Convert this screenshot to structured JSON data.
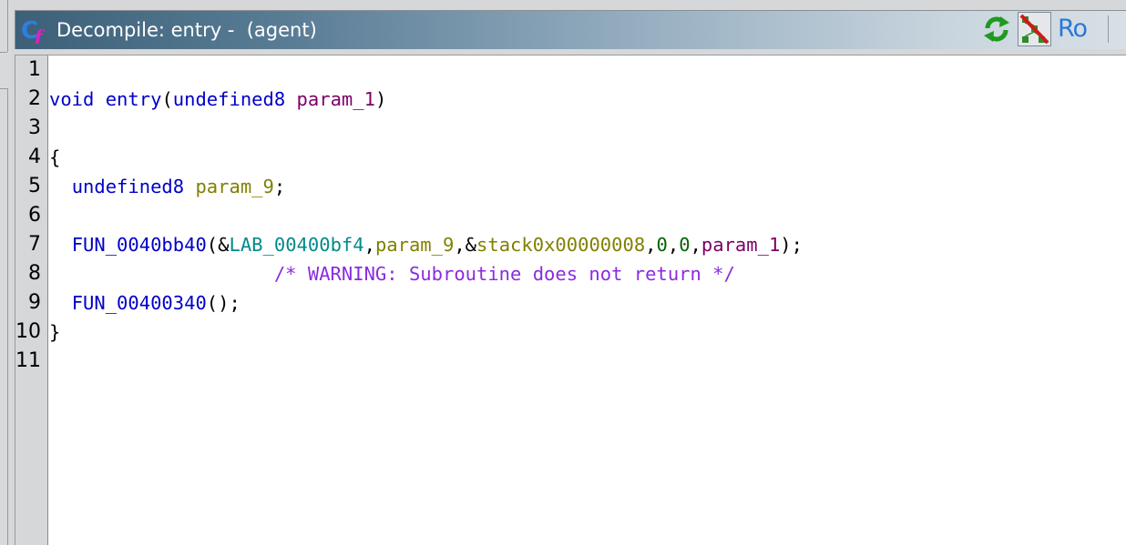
{
  "window": {
    "title": "Decompile: entry -  (agent)",
    "title_icon": "decompiler-cf-icon",
    "toolbar": {
      "refresh_icon": "refresh-icon",
      "graph_icon": "function-graph-icon",
      "ro_label": "Ro"
    }
  },
  "code": {
    "line_numbers": [
      "1",
      "2",
      "3",
      "4",
      "5",
      "6",
      "7",
      "8",
      "9",
      "10",
      "11"
    ],
    "lines": {
      "l2": {
        "kw_void": "void",
        "fn_name": "entry",
        "open": "(",
        "type": "undefined8",
        "param": "param_1",
        "close": ")"
      },
      "l4": {
        "brace": "{"
      },
      "l5": {
        "type": "undefined8",
        "var": "param_9",
        "semi": ";"
      },
      "l7": {
        "fn": "FUN_0040bb40",
        "p1": "(&",
        "label": "LAB_00400bf4",
        "c1": ",",
        "var": "param_9",
        "c2": ",&",
        "stack": "stack0x00000008",
        "c3": ",",
        "zero1": "0",
        "c4": ",",
        "zero2": "0",
        "c5": ",",
        "param": "param_1",
        "end": ");"
      },
      "l8": {
        "comment": "/* WARNING: Subroutine does not return */"
      },
      "l9": {
        "fn": "FUN_00400340",
        "end": "();"
      },
      "l10": {
        "brace": "}"
      }
    }
  },
  "colors": {
    "keyword": "#0000c8",
    "parameter": "#7b0067",
    "local_var": "#808000",
    "label": "#008a8a",
    "constant": "#006400",
    "comment": "#8a2be2"
  }
}
